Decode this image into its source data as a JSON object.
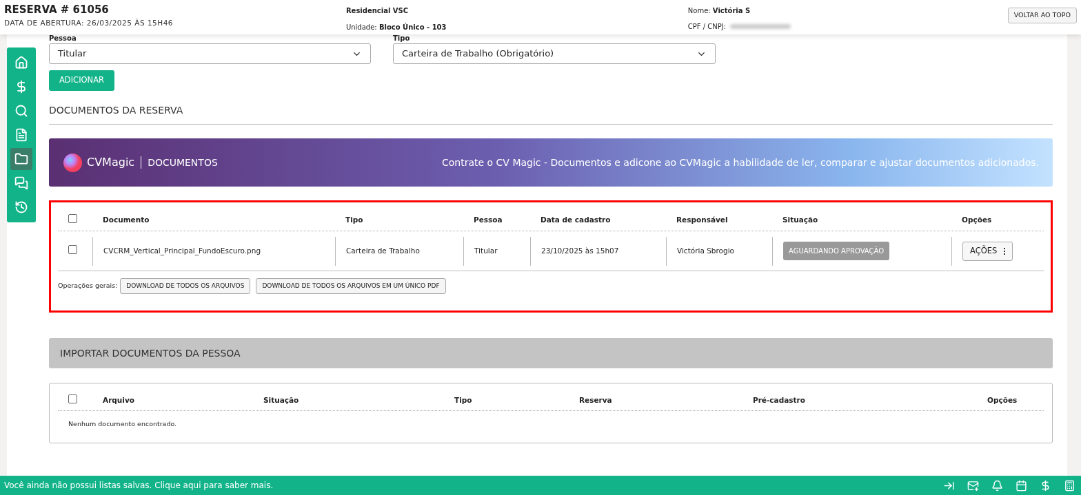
{
  "header": {
    "title": "RESERVA # 61056",
    "subtitle": "DATA DE ABERTURA: 26/03/2025 ÀS 15H46",
    "project": "Residencial VSC",
    "unit_label": "Unidade:",
    "unit_value": "Bloco Único - 103",
    "name_label": "Nome:",
    "name_value": "Victória S",
    "cpf_label": "CPF / CNPJ:",
    "cpf_redacted": true,
    "top_button": "VOLTAR AO TOPO"
  },
  "sidebar": {
    "items": [
      {
        "kind": "home",
        "selected": false
      },
      {
        "kind": "dollar",
        "selected": false
      },
      {
        "kind": "search",
        "selected": false
      },
      {
        "kind": "file",
        "selected": false
      },
      {
        "kind": "folder",
        "selected": true
      },
      {
        "kind": "chat",
        "selected": false
      },
      {
        "kind": "history",
        "selected": false
      }
    ]
  },
  "form": {
    "person_label": "Pessoa",
    "person_value": "Titular",
    "type_label": "Tipo",
    "type_value": "Carteira de Trabalho (Obrigatório)",
    "add_button": "ADICIONAR"
  },
  "section_title": "DOCUMENTOS DA RESERVA",
  "banner": {
    "brand": "CVMagic",
    "product": "DOCUMENTOS",
    "message": "Contrate o CV Magic - Documentos e adicone ao CVMagic a habilidade de ler, comparar e ajustar documentos adicionados."
  },
  "documents": {
    "highlighted": true,
    "columns": [
      "Documento",
      "Tipo",
      "Pessoa",
      "Data de cadastro",
      "Responsável",
      "Situação",
      "Opções"
    ],
    "header_checked": false,
    "rows": [
      {
        "checked": false,
        "cells": [
          "CVCRM_Vertical_Principal_FundoEscuro.png",
          "Carteira de Trabalho",
          "Titular",
          "23/10/2025 às 15h07",
          "Victória Sbrogio"
        ],
        "status": "AGUARDANDO APROVAÇÃO",
        "action": "AÇÕES"
      }
    ],
    "operations_label": "Operações gerais:",
    "operations": [
      "DOWNLOAD DE TODOS OS ARQUIVOS",
      "DOWNLOAD DE TODOS OS ARQUIVOS EM UM ÚNICO PDF"
    ]
  },
  "import": {
    "title": "IMPORTAR DOCUMENTOS DA PESSOA",
    "header_checked": false,
    "columns": [
      "Arquivo",
      "Situação",
      "Tipo",
      "Reserva",
      "Pré-cadastro",
      "Opções"
    ],
    "empty": "Nenhum documento encontrado."
  },
  "footer": {
    "message": "Você ainda não possui listas salvas. Clique aqui para saber mais.",
    "icons": [
      {
        "kind": "collapse"
      },
      {
        "kind": "mail"
      },
      {
        "kind": "bell"
      },
      {
        "kind": "calendar"
      },
      {
        "kind": "dollar"
      },
      {
        "kind": "calculator"
      }
    ]
  }
}
